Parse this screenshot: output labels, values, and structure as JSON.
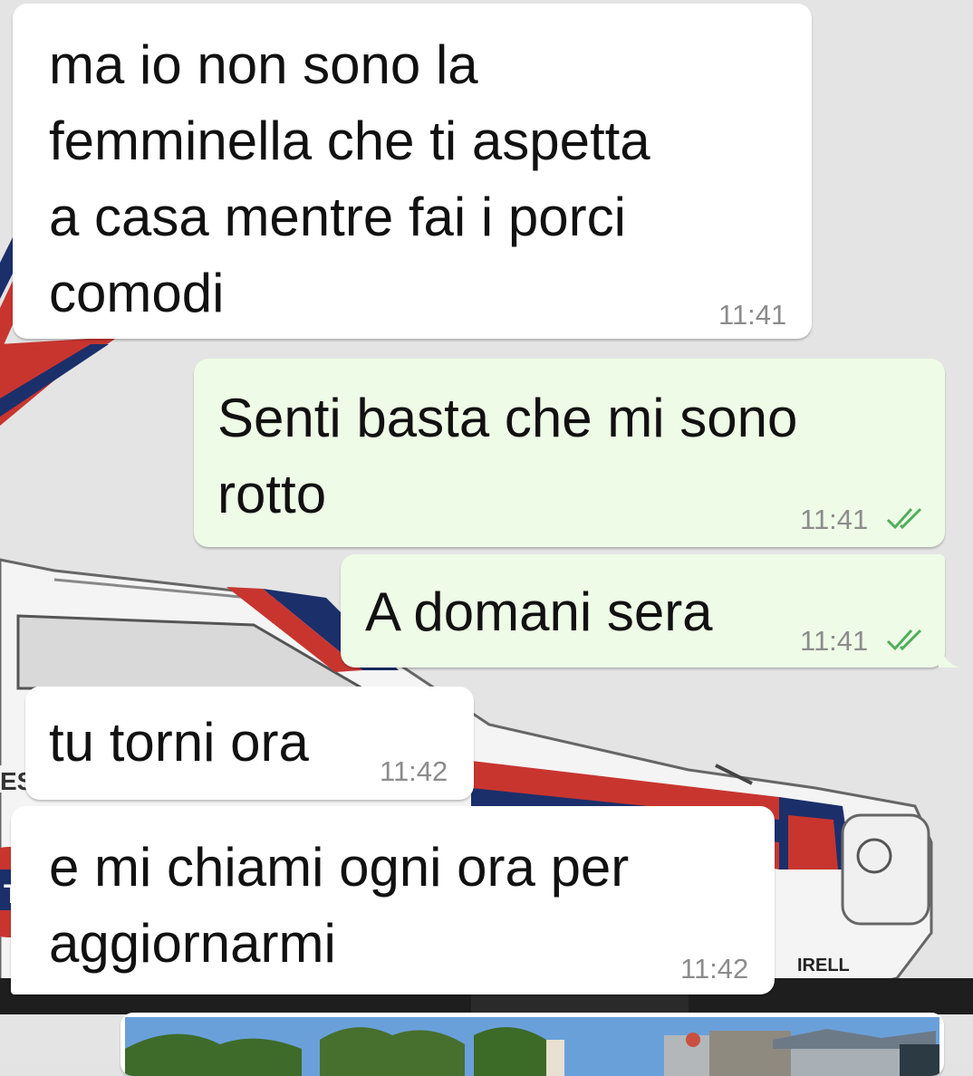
{
  "chat": {
    "messages": [
      {
        "direction": "incoming",
        "text": "ma io non sono la\nfemminella che ti aspetta\na casa mentre fai i porci\ncomodi",
        "time": "11:41"
      },
      {
        "direction": "outgoing",
        "text": "Senti basta che mi sono\nrotto",
        "time": "11:41",
        "status": "read"
      },
      {
        "direction": "outgoing",
        "text": "A domani sera",
        "time": "11:41",
        "status": "read"
      },
      {
        "direction": "incoming",
        "text": "tu torni ora",
        "time": "11:42"
      },
      {
        "direction": "incoming",
        "text": "e mi chiami ogni ora per\naggiornarmi",
        "time": "11:42"
      }
    ],
    "photo_message": {
      "type": "image"
    }
  },
  "colors": {
    "incoming_bubble": "#ffffff",
    "outgoing_bubble": "#eefbe6",
    "read_tick": "#4fae5c",
    "timestamp": "#8c8c8c",
    "header_bar": "#3e6f6a"
  }
}
